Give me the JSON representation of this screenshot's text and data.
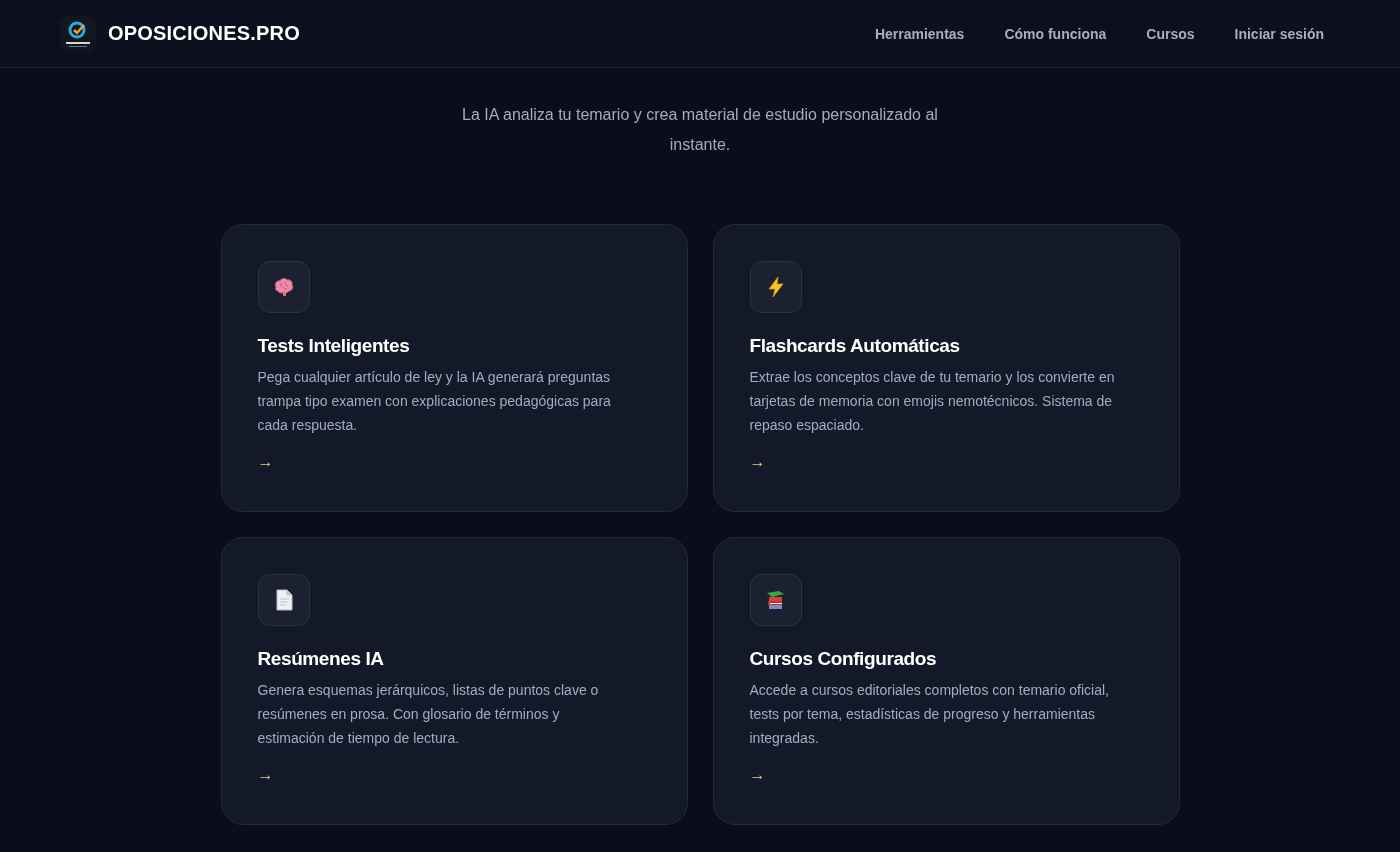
{
  "header": {
    "brand": "OPOSICIONES.PRO",
    "nav": [
      {
        "label": "Herramientas"
      },
      {
        "label": "Cómo funciona"
      },
      {
        "label": "Cursos"
      },
      {
        "label": "Iniciar sesión"
      }
    ]
  },
  "intro": {
    "subtitle": "La IA analiza tu temario y crea material de estudio personalizado al instante."
  },
  "features": [
    {
      "kind": "brain",
      "title": "Tests Inteligentes",
      "description": "Pega cualquier artículo de ley y la IA generará preguntas trampa tipo examen con explicaciones pedagógicas para cada respuesta.",
      "link": "→"
    },
    {
      "kind": "bolt",
      "title": "Flashcards Automáticas",
      "description": "Extrae los conceptos clave de tu temario y los convierte en tarjetas de memoria con emojis nemotécnicos. Sistema de repaso espaciado.",
      "link": "→"
    },
    {
      "kind": "document",
      "title": "Resúmenes IA",
      "description": "Genera esquemas jerárquicos, listas de puntos clave o resúmenes en prosa. Con glosario de términos y estimación de tiempo de lectura.",
      "link": "→"
    },
    {
      "kind": "books",
      "title": "Cursos Configurados",
      "description": "Accede a cursos editoriales completos con temario oficial, tests por tema, estadísticas de progreso y herramientas integradas.",
      "link": "→"
    }
  ]
}
